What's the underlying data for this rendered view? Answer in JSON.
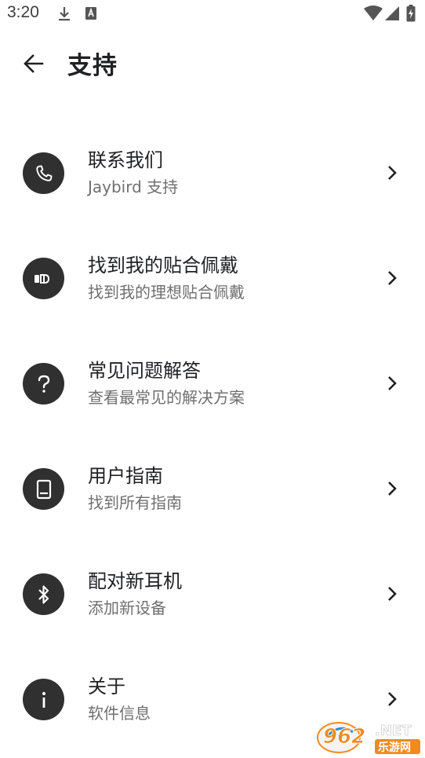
{
  "status_bar": {
    "time": "3:20"
  },
  "header": {
    "title": "支持"
  },
  "menu": {
    "items": [
      {
        "icon": "phone-icon",
        "title": "联系我们",
        "subtitle": "Jaybird 支持"
      },
      {
        "icon": "earbud-fit-icon",
        "title": "找到我的贴合佩戴",
        "subtitle": "找到我的理想贴合佩戴"
      },
      {
        "icon": "question-icon",
        "title": "常见问题解答",
        "subtitle": "查看最常见的解决方案"
      },
      {
        "icon": "guide-icon",
        "title": "用户指南",
        "subtitle": "找到所有指南"
      },
      {
        "icon": "bluetooth-icon",
        "title": "配对新耳机",
        "subtitle": "添加新设备"
      },
      {
        "icon": "info-icon",
        "title": "关于",
        "subtitle": "软件信息"
      }
    ]
  },
  "watermark": {
    "number": "962",
    "suffix": ".NET",
    "text": "乐游网"
  },
  "colors": {
    "icon_bg": "#303030",
    "title": "#202124",
    "subtitle": "#6f6f6f",
    "watermark_orange": "#f28a1f"
  }
}
